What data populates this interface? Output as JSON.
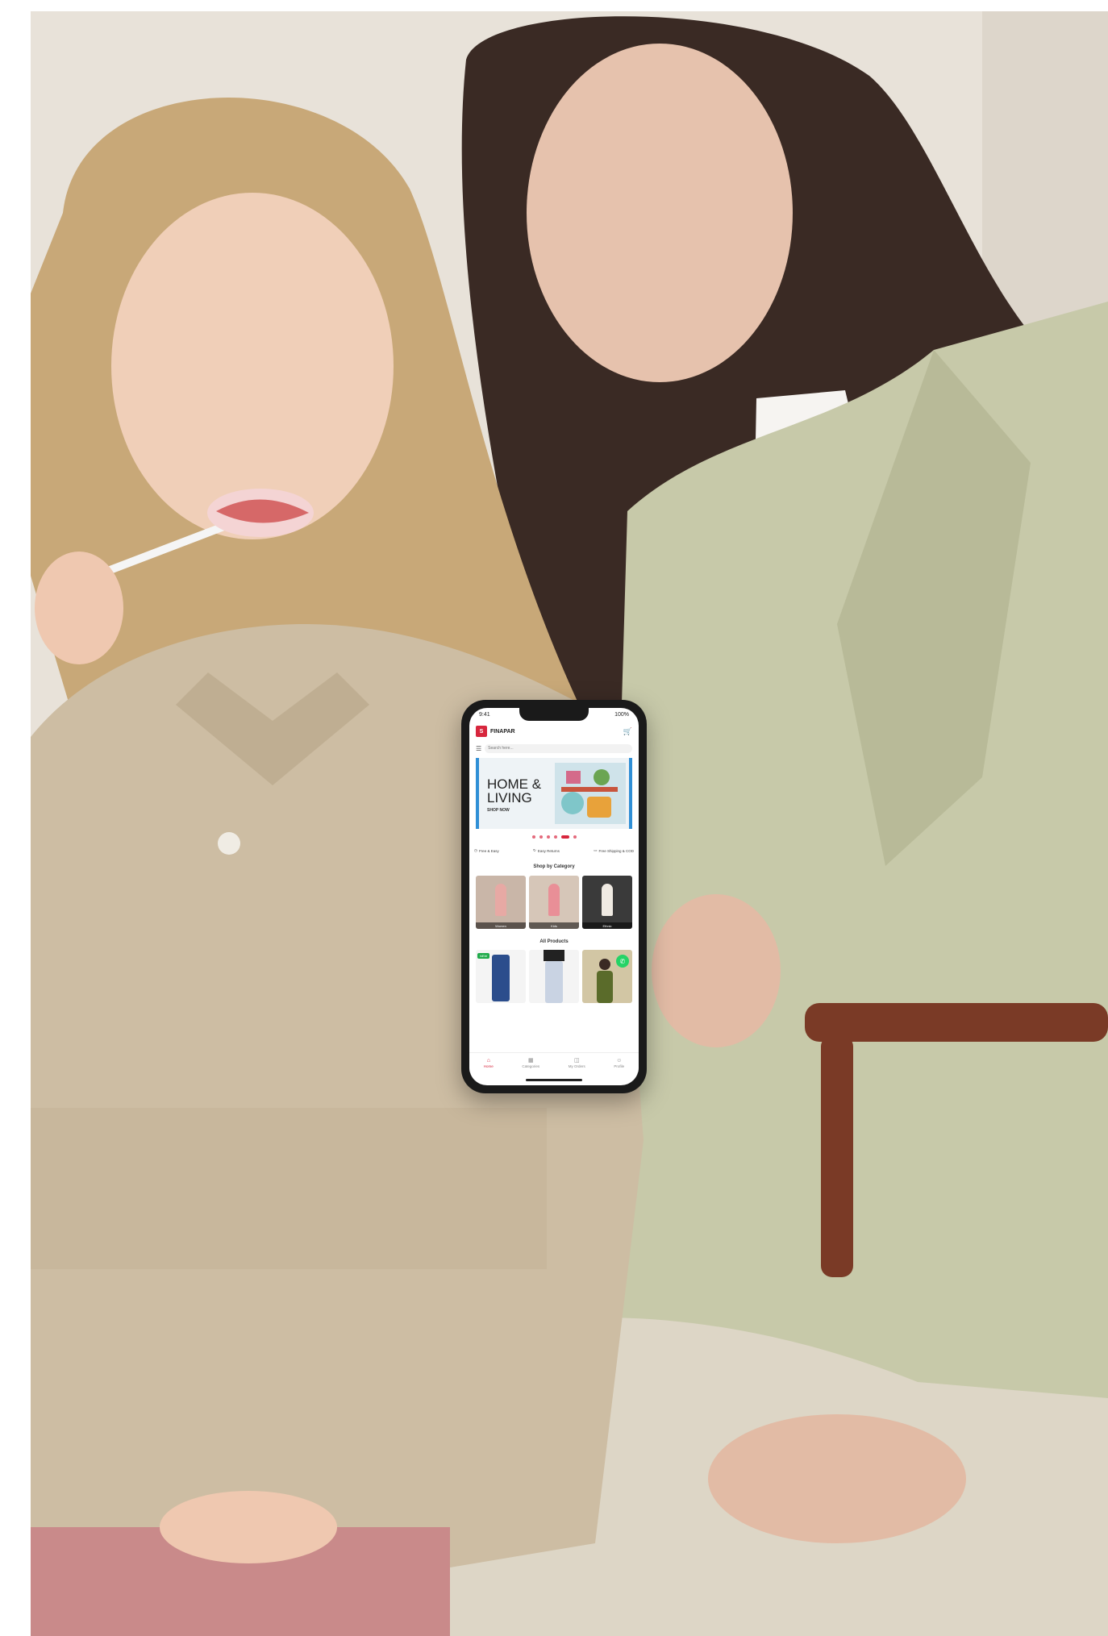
{
  "app": {
    "logo_text": "S",
    "brand_name": "FINAPAR",
    "search_placeholder": "Search here...",
    "status": {
      "time": "9:41",
      "battery": "100%"
    }
  },
  "banner": {
    "title": "HOME & LIVING",
    "cta": "SHOP NOW"
  },
  "carousel": {
    "dot_count": 6,
    "active_index": 5
  },
  "features": [
    {
      "icon": "clock-icon",
      "label": "Free & Easy"
    },
    {
      "icon": "refresh-icon",
      "label": "Easy Returns"
    },
    {
      "icon": "truck-icon",
      "label": "Free Shipping & COD"
    }
  ],
  "sections": {
    "categories_title": "Shop by Category",
    "products_title": "All Products"
  },
  "categories": [
    {
      "caption": "Women"
    },
    {
      "caption": "Kids"
    },
    {
      "caption": "Ethnic"
    }
  ],
  "products": [
    {
      "badge": "NEW"
    },
    {
      "badge": ""
    },
    {
      "badge": ""
    }
  ],
  "bottom_nav": [
    {
      "icon": "home-icon",
      "label": "Home",
      "active": true
    },
    {
      "icon": "grid-icon",
      "label": "Categories",
      "active": false
    },
    {
      "icon": "bag-icon",
      "label": "My Orders",
      "active": false
    },
    {
      "icon": "user-icon",
      "label": "Profile",
      "active": false
    }
  ],
  "colors": {
    "brand_red": "#d7263d",
    "whatsapp_green": "#25d366",
    "banner_accent": "#2f8fd6"
  }
}
